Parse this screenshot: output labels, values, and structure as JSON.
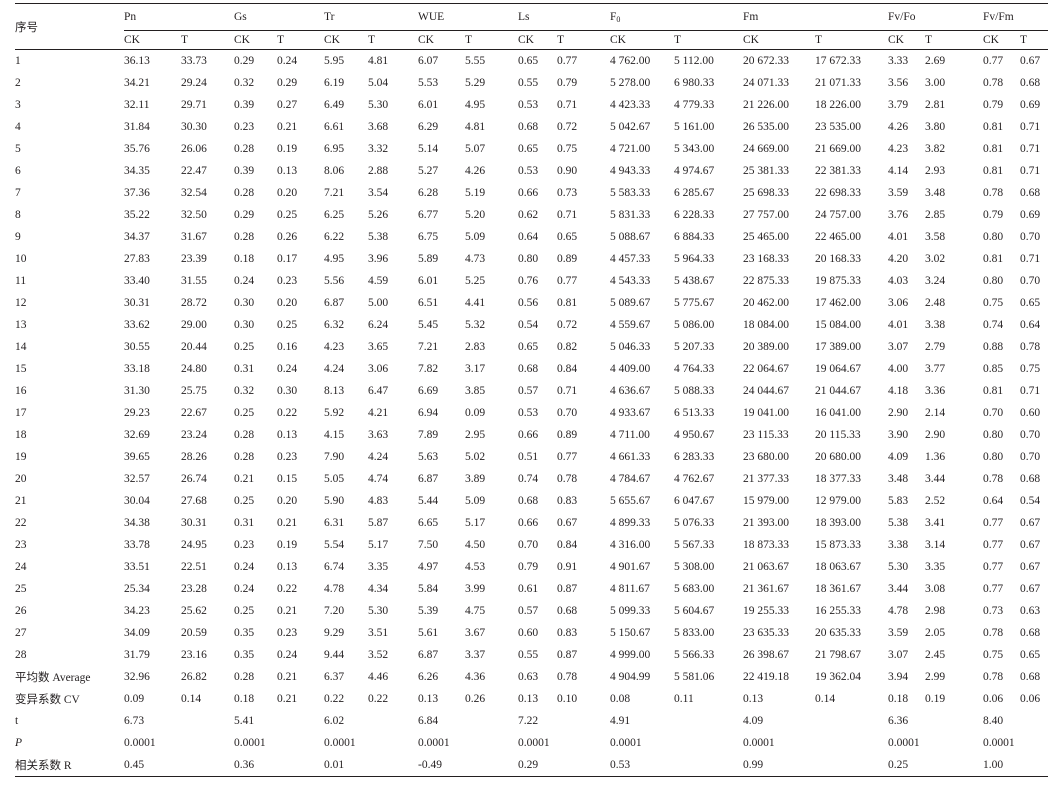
{
  "table": {
    "row_header": "序号",
    "groups": [
      {
        "name": "Pn",
        "sub": ""
      },
      {
        "name": "Gs",
        "sub": ""
      },
      {
        "name": "Tr",
        "sub": ""
      },
      {
        "name": "WUE",
        "sub": ""
      },
      {
        "name": "Ls",
        "sub": ""
      },
      {
        "name": "F",
        "sub": "0"
      },
      {
        "name": "Fm",
        "sub": ""
      },
      {
        "name": "Fv/Fo",
        "sub": ""
      },
      {
        "name": "Fv/Fm",
        "sub": ""
      }
    ],
    "subheaders": [
      "CK",
      "T"
    ],
    "rows": [
      [
        "1",
        "36.13",
        "33.73",
        "0.29",
        "0.24",
        "5.95",
        "4.81",
        "6.07",
        "5.55",
        "0.65",
        "0.77",
        "4 762.00",
        "5 112.00",
        "20 672.33",
        "17 672.33",
        "3.33",
        "2.69",
        "0.77",
        "0.67"
      ],
      [
        "2",
        "34.21",
        "29.24",
        "0.32",
        "0.29",
        "6.19",
        "5.04",
        "5.53",
        "5.29",
        "0.55",
        "0.79",
        "5 278.00",
        "6 980.33",
        "24 071.33",
        "21 071.33",
        "3.56",
        "3.00",
        "0.78",
        "0.68"
      ],
      [
        "3",
        "32.11",
        "29.71",
        "0.39",
        "0.27",
        "6.49",
        "5.30",
        "6.01",
        "4.95",
        "0.53",
        "0.71",
        "4 423.33",
        "4 779.33",
        "21 226.00",
        "18 226.00",
        "3.79",
        "2.81",
        "0.79",
        "0.69"
      ],
      [
        "4",
        "31.84",
        "30.30",
        "0.23",
        "0.21",
        "6.61",
        "3.68",
        "6.29",
        "4.81",
        "0.68",
        "0.72",
        "5 042.67",
        "5 161.00",
        "26 535.00",
        "23 535.00",
        "4.26",
        "3.80",
        "0.81",
        "0.71"
      ],
      [
        "5",
        "35.76",
        "26.06",
        "0.28",
        "0.19",
        "6.95",
        "3.32",
        "5.14",
        "5.07",
        "0.65",
        "0.75",
        "4 721.00",
        "5 343.00",
        "24 669.00",
        "21 669.00",
        "4.23",
        "3.82",
        "0.81",
        "0.71"
      ],
      [
        "6",
        "34.35",
        "22.47",
        "0.39",
        "0.13",
        "8.06",
        "2.88",
        "5.27",
        "4.26",
        "0.53",
        "0.90",
        "4 943.33",
        "4 974.67",
        "25 381.33",
        "22 381.33",
        "4.14",
        "2.93",
        "0.81",
        "0.71"
      ],
      [
        "7",
        "37.36",
        "32.54",
        "0.28",
        "0.20",
        "7.21",
        "3.54",
        "6.28",
        "5.19",
        "0.66",
        "0.73",
        "5 583.33",
        "6 285.67",
        "25 698.33",
        "22 698.33",
        "3.59",
        "3.48",
        "0.78",
        "0.68"
      ],
      [
        "8",
        "35.22",
        "32.50",
        "0.29",
        "0.25",
        "6.25",
        "5.26",
        "6.77",
        "5.20",
        "0.62",
        "0.71",
        "5 831.33",
        "6 228.33",
        "27 757.00",
        "24 757.00",
        "3.76",
        "2.85",
        "0.79",
        "0.69"
      ],
      [
        "9",
        "34.37",
        "31.67",
        "0.28",
        "0.26",
        "6.22",
        "5.38",
        "6.75",
        "5.09",
        "0.64",
        "0.65",
        "5 088.67",
        "6 884.33",
        "25 465.00",
        "22 465.00",
        "4.01",
        "3.58",
        "0.80",
        "0.70"
      ],
      [
        "10",
        "27.83",
        "23.39",
        "0.18",
        "0.17",
        "4.95",
        "3.96",
        "5.89",
        "4.73",
        "0.80",
        "0.89",
        "4 457.33",
        "5 964.33",
        "23 168.33",
        "20 168.33",
        "4.20",
        "3.02",
        "0.81",
        "0.71"
      ],
      [
        "11",
        "33.40",
        "31.55",
        "0.24",
        "0.23",
        "5.56",
        "4.59",
        "6.01",
        "5.25",
        "0.76",
        "0.77",
        "4 543.33",
        "5 438.67",
        "22 875.33",
        "19 875.33",
        "4.03",
        "3.24",
        "0.80",
        "0.70"
      ],
      [
        "12",
        "30.31",
        "28.72",
        "0.30",
        "0.20",
        "6.87",
        "5.00",
        "6.51",
        "4.41",
        "0.56",
        "0.81",
        "5 089.67",
        "5 775.67",
        "20 462.00",
        "17 462.00",
        "3.06",
        "2.48",
        "0.75",
        "0.65"
      ],
      [
        "13",
        "33.62",
        "29.00",
        "0.30",
        "0.25",
        "6.32",
        "6.24",
        "5.45",
        "5.32",
        "0.54",
        "0.72",
        "4 559.67",
        "5 086.00",
        "18 084.00",
        "15 084.00",
        "4.01",
        "3.38",
        "0.74",
        "0.64"
      ],
      [
        "14",
        "30.55",
        "20.44",
        "0.25",
        "0.16",
        "4.23",
        "3.65",
        "7.21",
        "2.83",
        "0.65",
        "0.82",
        "5 046.33",
        "5 207.33",
        "20 389.00",
        "17 389.00",
        "3.07",
        "2.79",
        "0.88",
        "0.78"
      ],
      [
        "15",
        "33.18",
        "24.80",
        "0.31",
        "0.24",
        "4.24",
        "3.06",
        "7.82",
        "3.17",
        "0.68",
        "0.84",
        "4 409.00",
        "4 764.33",
        "22 064.67",
        "19 064.67",
        "4.00",
        "3.77",
        "0.85",
        "0.75"
      ],
      [
        "16",
        "31.30",
        "25.75",
        "0.32",
        "0.30",
        "8.13",
        "6.47",
        "6.69",
        "3.85",
        "0.57",
        "0.71",
        "4 636.67",
        "5 088.33",
        "24 044.67",
        "21 044.67",
        "4.18",
        "3.36",
        "0.81",
        "0.71"
      ],
      [
        "17",
        "29.23",
        "22.67",
        "0.25",
        "0.22",
        "5.92",
        "4.21",
        "6.94",
        "0.09",
        "0.53",
        "0.70",
        "4 933.67",
        "6 513.33",
        "19 041.00",
        "16 041.00",
        "2.90",
        "2.14",
        "0.70",
        "0.60"
      ],
      [
        "18",
        "32.69",
        "23.24",
        "0.28",
        "0.13",
        "4.15",
        "3.63",
        "7.89",
        "2.95",
        "0.66",
        "0.89",
        "4 711.00",
        "4 950.67",
        "23 115.33",
        "20 115.33",
        "3.90",
        "2.90",
        "0.80",
        "0.70"
      ],
      [
        "19",
        "39.65",
        "28.26",
        "0.28",
        "0.23",
        "7.90",
        "4.24",
        "5.63",
        "5.02",
        "0.51",
        "0.77",
        "4 661.33",
        "6 283.33",
        "23 680.00",
        "20 680.00",
        "4.09",
        "1.36",
        "0.80",
        "0.70"
      ],
      [
        "20",
        "32.57",
        "26.74",
        "0.21",
        "0.15",
        "5.05",
        "4.74",
        "6.87",
        "3.89",
        "0.74",
        "0.78",
        "4 784.67",
        "4 762.67",
        "21 377.33",
        "18 377.33",
        "3.48",
        "3.44",
        "0.78",
        "0.68"
      ],
      [
        "21",
        "30.04",
        "27.68",
        "0.25",
        "0.20",
        "5.90",
        "4.83",
        "5.44",
        "5.09",
        "0.68",
        "0.83",
        "5 655.67",
        "6 047.67",
        "15 979.00",
        "12 979.00",
        "5.83",
        "2.52",
        "0.64",
        "0.54"
      ],
      [
        "22",
        "34.38",
        "30.31",
        "0.31",
        "0.21",
        "6.31",
        "5.87",
        "6.65",
        "5.17",
        "0.66",
        "0.67",
        "4 899.33",
        "5 076.33",
        "21 393.00",
        "18 393.00",
        "5.38",
        "3.41",
        "0.77",
        "0.67"
      ],
      [
        "23",
        "33.78",
        "24.95",
        "0.23",
        "0.19",
        "5.54",
        "5.17",
        "7.50",
        "4.50",
        "0.70",
        "0.84",
        "4 316.00",
        "5 567.33",
        "18 873.33",
        "15 873.33",
        "3.38",
        "3.14",
        "0.77",
        "0.67"
      ],
      [
        "24",
        "33.51",
        "22.51",
        "0.24",
        "0.13",
        "6.74",
        "3.35",
        "4.97",
        "4.53",
        "0.79",
        "0.91",
        "4 901.67",
        "5 308.00",
        "21 063.67",
        "18 063.67",
        "5.30",
        "3.35",
        "0.77",
        "0.67"
      ],
      [
        "25",
        "25.34",
        "23.28",
        "0.24",
        "0.22",
        "4.78",
        "4.34",
        "5.84",
        "3.99",
        "0.61",
        "0.87",
        "4 811.67",
        "5 683.00",
        "21 361.67",
        "18 361.67",
        "3.44",
        "3.08",
        "0.77",
        "0.67"
      ],
      [
        "26",
        "34.23",
        "25.62",
        "0.25",
        "0.21",
        "7.20",
        "5.30",
        "5.39",
        "4.75",
        "0.57",
        "0.68",
        "5 099.33",
        "5 604.67",
        "19 255.33",
        "16 255.33",
        "4.78",
        "2.98",
        "0.73",
        "0.63"
      ],
      [
        "27",
        "34.09",
        "20.59",
        "0.35",
        "0.23",
        "9.29",
        "3.51",
        "5.61",
        "3.67",
        "0.60",
        "0.83",
        "5 150.67",
        "5 833.00",
        "23 635.33",
        "20 635.33",
        "3.59",
        "2.05",
        "0.78",
        "0.68"
      ],
      [
        "28",
        "31.79",
        "23.16",
        "0.35",
        "0.24",
        "9.44",
        "3.52",
        "6.87",
        "3.37",
        "0.55",
        "0.87",
        "4 999.00",
        "5 566.33",
        "26 398.67",
        "21 798.67",
        "3.07",
        "2.45",
        "0.75",
        "0.65"
      ],
      [
        "平均数 Average",
        "32.96",
        "26.82",
        "0.28",
        "0.21",
        "6.37",
        "4.46",
        "6.26",
        "4.36",
        "0.63",
        "0.78",
        "4 904.99",
        "5 581.06",
        "22 419.18",
        "19 362.04",
        "3.94",
        "2.99",
        "0.78",
        "0.68"
      ],
      [
        "变异系数 CV",
        "0.09",
        "0.14",
        "0.18",
        "0.21",
        "0.22",
        "0.22",
        "0.13",
        "0.26",
        "0.13",
        "0.10",
        "0.08",
        "0.11",
        "0.13",
        "0.14",
        "0.18",
        "0.19",
        "0.06",
        "0.06"
      ]
    ],
    "stats": [
      {
        "label": "t",
        "italic": false,
        "values": [
          "6.73",
          "5.41",
          "6.02",
          "6.84",
          "7.22",
          "4.91",
          "4.09",
          "6.36",
          "8.40"
        ]
      },
      {
        "label": "P",
        "italic": true,
        "values": [
          "0.0001",
          "0.0001",
          "0.0001",
          "0.0001",
          "0.0001",
          "0.0001",
          "0.0001",
          "0.0001",
          "0.0001"
        ]
      },
      {
        "label": "相关系数 R",
        "italic": false,
        "values": [
          "0.45",
          "0.36",
          "0.01",
          "-0.49",
          "0.29",
          "0.53",
          "0.99",
          "0.25",
          "1.00"
        ]
      }
    ]
  }
}
